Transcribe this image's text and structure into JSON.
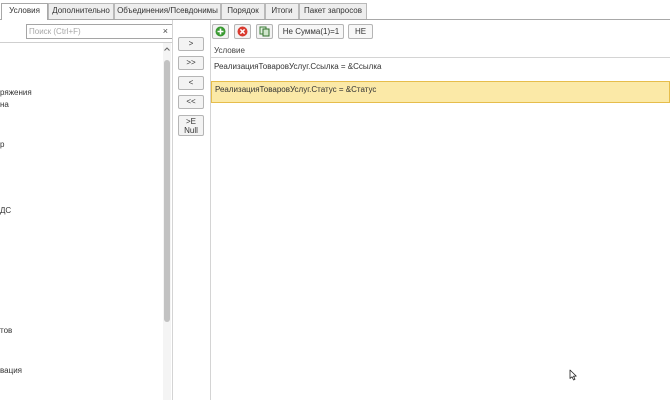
{
  "tabs": [
    {
      "label": "Условия",
      "active": true
    },
    {
      "label": "Дополнительно",
      "active": false
    },
    {
      "label": "Объединения/Псевдонимы",
      "active": false
    },
    {
      "label": "Порядок",
      "active": false
    },
    {
      "label": "Итоги",
      "active": false
    },
    {
      "label": "Пакет запросов",
      "active": false
    }
  ],
  "search": {
    "placeholder": "Поиск (Ctrl+F)",
    "value": "",
    "clear_icon": "×"
  },
  "left_tree": {
    "items": [
      "ряжения",
      "на",
      "р",
      "ДС",
      "тов",
      "вация"
    ]
  },
  "transfer_buttons": {
    "add": ">",
    "add_all": ">>",
    "remove": "<",
    "remove_all": "<<",
    "null_line1": ">E",
    "null_line2": "Null"
  },
  "toolbar": {
    "add_icon": "add-icon",
    "delete_icon": "delete-icon",
    "copy_icon": "copy-icon",
    "not_sum_label": "Не Сумма(1)=1",
    "not_label": "НЕ"
  },
  "grid": {
    "header": "Условие",
    "rows": [
      {
        "text": "РеализацияТоваровУслуг.Ссылка = &Ссылка",
        "selected": false
      },
      {
        "text": "РеализацияТоваровУслуг.Статус = &Статус",
        "selected": true
      }
    ]
  },
  "colors": {
    "selected_row": "#fbe9a7",
    "selected_border": "#e6bd4b",
    "add_green": "#3a9a32",
    "delete_red": "#d93a2f"
  }
}
